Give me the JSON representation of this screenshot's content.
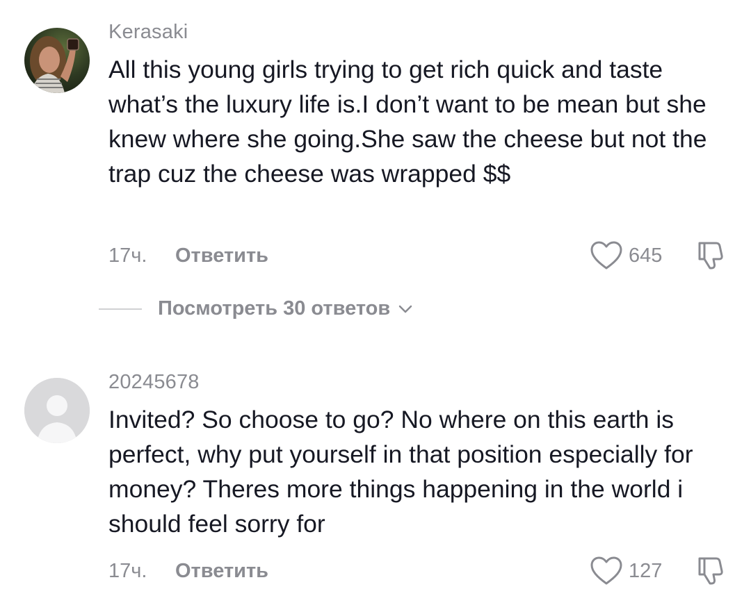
{
  "comments": [
    {
      "username": "Kerasaki",
      "avatar_icon": "user-photo",
      "text": "All this young girls trying to get rich quick and taste what’s the luxury life is.I don’t want to be mean but she knew where she going.She saw the cheese but not the trap cuz the cheese was wrapped $$",
      "time": "17ч.",
      "reply_label": "Ответить",
      "likes": "645"
    },
    {
      "username": "20245678",
      "avatar_icon": "default-user-avatar",
      "text": "Invited? So choose to go? No where on this earth is perfect, why put yourself in that position especially for money? Theres more things happening in the world i should feel sorry for",
      "time": "17ч.",
      "reply_label": "Ответить",
      "likes": "127"
    }
  ],
  "view_replies": {
    "label": "Посмотреть 30 ответов"
  },
  "colors": {
    "text_primary": "#161823",
    "text_secondary": "#8a8b91",
    "divider": "#d0d1d3",
    "default_avatar_bg": "#d9d9db"
  }
}
